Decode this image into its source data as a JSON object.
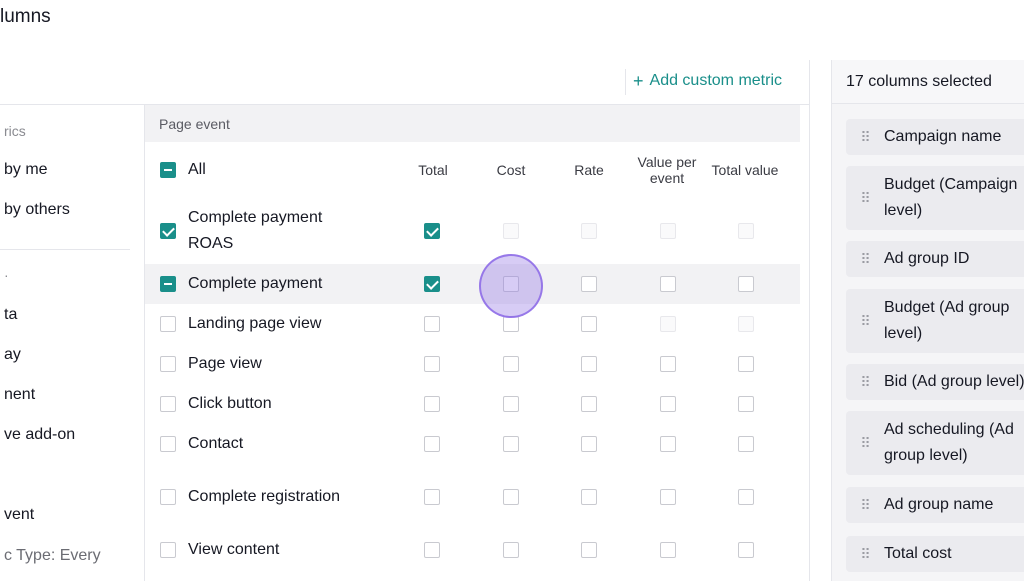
{
  "title": "lumns",
  "sidebar": {
    "items": [
      "rics",
      "by me",
      "by others",
      "ta",
      "ay",
      "nent",
      "ve add-on",
      "vent",
      "c Type: Every"
    ]
  },
  "toolbar": {
    "add_custom_metric": "Add custom metric",
    "add_icon": "+"
  },
  "table": {
    "group": "Page event",
    "all_label": "All",
    "columns": [
      "Total",
      "Cost",
      "Rate",
      "Value per event",
      "Total value"
    ],
    "rows": [
      {
        "name": "Complete payment ROAS",
        "state": "checked",
        "cells": [
          "checked",
          "disabled",
          "disabled",
          "disabled",
          "disabled"
        ]
      },
      {
        "name": "Complete payment",
        "state": "indeterminate",
        "cells": [
          "checked",
          "unchecked",
          "unchecked",
          "unchecked",
          "unchecked"
        ]
      },
      {
        "name": "Landing page view",
        "state": "unchecked",
        "cells": [
          "unchecked",
          "unchecked",
          "unchecked",
          "disabled",
          "disabled"
        ]
      },
      {
        "name": "Page view",
        "state": "unchecked",
        "cells": [
          "unchecked",
          "unchecked",
          "unchecked",
          "unchecked",
          "unchecked"
        ]
      },
      {
        "name": "Click button",
        "state": "unchecked",
        "cells": [
          "unchecked",
          "unchecked",
          "unchecked",
          "unchecked",
          "unchecked"
        ]
      },
      {
        "name": "Contact",
        "state": "unchecked",
        "cells": [
          "unchecked",
          "unchecked",
          "unchecked",
          "unchecked",
          "unchecked"
        ]
      },
      {
        "name": "Complete registration",
        "state": "unchecked",
        "cells": [
          "unchecked",
          "unchecked",
          "unchecked",
          "unchecked",
          "unchecked"
        ]
      },
      {
        "name": "View content",
        "state": "unchecked",
        "cells": [
          "unchecked",
          "unchecked",
          "unchecked",
          "unchecked",
          "unchecked"
        ]
      }
    ]
  },
  "selected_panel": {
    "header": "17 columns selected",
    "items": [
      "Campaign name",
      "Budget (Campaign level)",
      "Ad group ID",
      "Budget (Ad group level)",
      "Bid (Ad group level)",
      "Ad scheduling (Ad group level)",
      "Ad group name",
      "Total cost"
    ]
  },
  "colors": {
    "accent": "#1a8f8a",
    "cursor_highlight": "#9678e6"
  }
}
